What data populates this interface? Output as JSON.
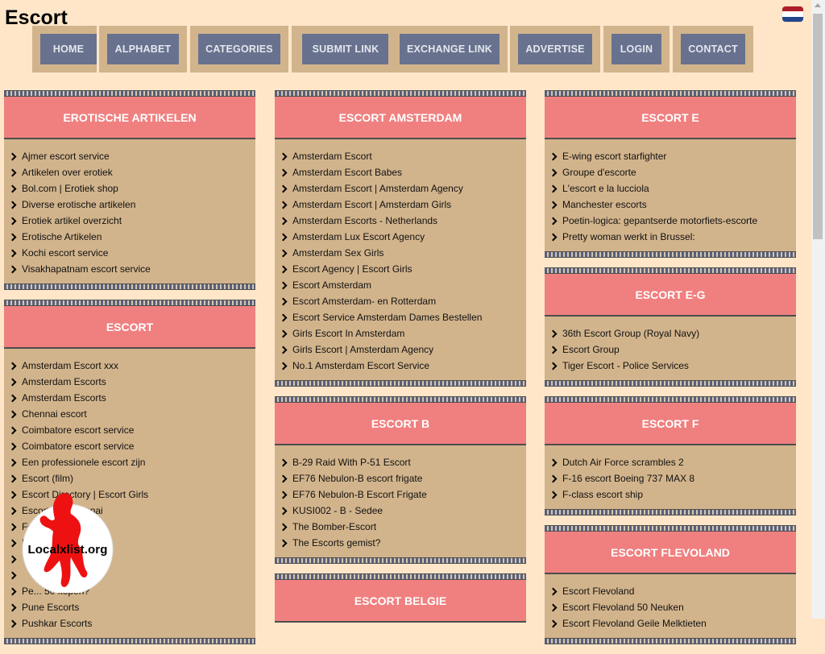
{
  "site": {
    "title": "Escort",
    "language_flag": "netherlands-flag-icon",
    "flag_colors": [
      "#ae1c28",
      "#ffffff",
      "#21468b"
    ]
  },
  "colors": {
    "page_bg": "#ffe6c9",
    "block_bg": "#d2b48c",
    "header_bg": "#f08080",
    "nav_button": "#68728e"
  },
  "nav": [
    "Home",
    "Alphabet",
    "Categories",
    "Submit link",
    "Exchange link",
    "Advertise",
    "Login",
    "Contact"
  ],
  "columns": [
    [
      {
        "title": "Erotische artikelen",
        "links": [
          "Ajmer escort service",
          "Artikelen over erotiek",
          "Bol.com | Erotiek shop",
          "Diverse erotische artikelen",
          "Erotiek artikel overzicht",
          "Erotische Artikelen",
          "Kochi escort service",
          "Visakhapatnam escort service"
        ]
      },
      {
        "title": "Escort",
        "links": [
          "Amsterdam Escort xxx",
          "Amsterdam Escorts",
          "Amsterdam Escorts",
          "Chennai escort",
          "Coimbatore escort service",
          "Coimbatore escort service",
          "Een professionele escort zijn",
          "Escort (film)",
          "Escort Directory | Escort Girls",
          "Escorts in Chennai",
          "Ford Escort Mission",
          "H",
          "",
          "",
          "Pe... 50 kopen?",
          "Pune Escorts",
          "Pushkar Escorts"
        ]
      }
    ],
    [
      {
        "title": "Escort Amsterdam",
        "links": [
          "Amsterdam Escort",
          "Amsterdam Escort Babes",
          "Amsterdam Escort | Amsterdam Agency",
          "Amsterdam Escort | Amsterdam Girls",
          "Amsterdam Escorts - Netherlands",
          "Amsterdam Lux Escort Agency",
          "Amsterdam Sex Girls",
          "Escort Agency | Escort Girls",
          "Escort Amsterdam",
          "Escort Amsterdam- en Rotterdam",
          "Escort Service Amsterdam Dames Bestellen",
          "Girls Escort In Amsterdam",
          "Girls Escort | Amsterdam Agency",
          "No.1 Amsterdam Escort Service"
        ]
      },
      {
        "title": "Escort B",
        "links": [
          "B-29 Raid With P-51 Escort",
          "EF76 Nebulon-B escort frigate",
          "EF76 Nebulon-B Escort Frigate",
          "KUSI002 - B - Sedee",
          "The Bomber-Escort",
          "The Escorts gemist?"
        ]
      },
      {
        "title": "Escort Belgie",
        "links": []
      }
    ],
    [
      {
        "title": "Escort E",
        "links": [
          "E-wing escort starfighter",
          "Groupe d'escorte",
          "L'escort e la lucciola",
          "Manchester escorts",
          "Poetin-logica: gepantserde motorfiets-escorte",
          "Pretty woman werkt in Brussel:"
        ]
      },
      {
        "title": "Escort E-G",
        "links": [
          "36th Escort Group (Royal Navy)",
          "Escort Group",
          "Tiger Escort - Police Services"
        ]
      },
      {
        "title": "Escort F",
        "links": [
          "Dutch Air Force scrambles 2",
          "F-16 escort Boeing 737 MAX 8",
          "F-class escort ship"
        ]
      },
      {
        "title": "Escort Flevoland",
        "links": [
          "Escort Flevoland",
          "Escort Flevoland 50 Neuken",
          "Escort Flevoland Geile Melktieten"
        ]
      }
    ]
  ],
  "watermark": {
    "text": "Localxlist.org",
    "icon": "silhouette-logo-icon"
  }
}
